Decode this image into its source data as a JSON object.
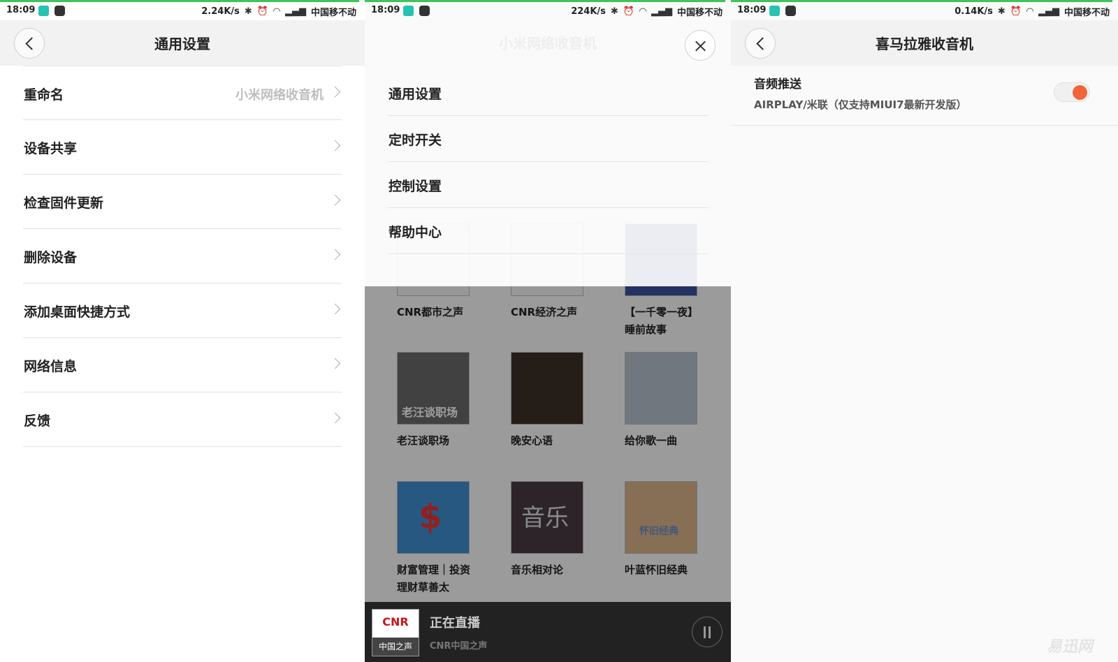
{
  "status_bars": [
    {
      "time": "18:09",
      "speed": "2.24K/s",
      "carrier": "中国移不动"
    },
    {
      "time": "18:09",
      "speed": "224K/s",
      "carrier": "中国移不动"
    },
    {
      "time": "18:09",
      "speed": "0.14K/s",
      "carrier": "中国移不动"
    }
  ],
  "panel1": {
    "title": "通用设置",
    "rows": [
      {
        "label": "重命名",
        "value": "小米网络收音机"
      },
      {
        "label": "设备共享",
        "value": ""
      },
      {
        "label": "检查固件更新",
        "value": ""
      },
      {
        "label": "删除设备",
        "value": ""
      },
      {
        "label": "添加桌面快捷方式",
        "value": ""
      },
      {
        "label": "网络信息",
        "value": ""
      },
      {
        "label": "反馈",
        "value": ""
      }
    ]
  },
  "panel2": {
    "background_title": "小米网络收音机",
    "menu": [
      "通用设置",
      "定时开关",
      "控制设置",
      "帮助中心"
    ],
    "programs": [
      {
        "caption": "CNR都市之声",
        "color": "#f4f4f4",
        "label": ""
      },
      {
        "caption": "CNR经济之声",
        "color": "#f4f4f4",
        "label": ""
      },
      {
        "caption": "【一千零一夜】睡前故事",
        "color": "#3a4fa0",
        "label": ""
      },
      {
        "caption": "老汪谈职场",
        "color": "#6a6a6a",
        "label": "老汪谈职场"
      },
      {
        "caption": "晚安心语",
        "color": "#3a2f28",
        "label": ""
      },
      {
        "caption": "给你歌一曲",
        "color": "#b7c0cc",
        "label": ""
      },
      {
        "caption": "财富管理｜投资理财草善太",
        "color": "#3f8fd0",
        "label": "$"
      },
      {
        "caption": "音乐相对论",
        "color": "#4a3a45",
        "label": "音乐"
      },
      {
        "caption": "叶蓝怀旧经典",
        "color": "#d9b48a",
        "label": "怀旧经典"
      }
    ],
    "player": {
      "status": "正在直播",
      "station": "CNR中国之声",
      "logo": "CNR",
      "logo_sub": "中国之声"
    }
  },
  "panel3": {
    "title": "喜马拉雅收音机",
    "setting_label": "音频推送",
    "setting_desc": "AIRPLAY/米联（仅支持MIUI7最新开发版）",
    "toggle_on": true,
    "accent": "#f0653a",
    "watermark": "易迅网"
  }
}
